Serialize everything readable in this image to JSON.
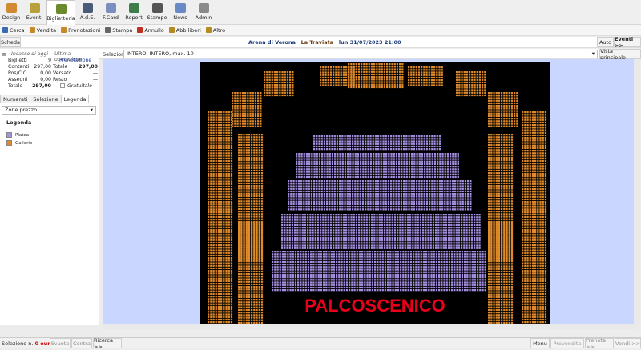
{
  "toolbar": {
    "items": [
      {
        "label": "Design",
        "color": "#d08a32"
      },
      {
        "label": "Eventi",
        "color": "#b7a13a"
      },
      {
        "label": "Biglietteria",
        "color": "#6a8a2c"
      },
      {
        "label": "A.d.E.",
        "color": "#4a5a7a"
      },
      {
        "label": "F.Card",
        "color": "#7a8fbf"
      },
      {
        "label": "Report",
        "color": "#3e7d4a"
      },
      {
        "label": "Stampe",
        "color": "#555555"
      },
      {
        "label": "News",
        "color": "#6a8ac7"
      },
      {
        "label": "Admin",
        "color": "#8a8a8a"
      }
    ]
  },
  "subbar": {
    "items": [
      {
        "label": "Cerca",
        "color": "#3a6ab0"
      },
      {
        "label": "Vendita",
        "color": "#c58a2a"
      },
      {
        "label": "Prenotazioni",
        "color": "#c58a2a"
      },
      {
        "label": "Stampa",
        "color": "#666666"
      },
      {
        "label": "Annullo",
        "color": "#c03020"
      },
      {
        "label": "Abb.liberi",
        "color": "#b58a20"
      },
      {
        "label": "Altro",
        "color": "#b58a20"
      }
    ]
  },
  "scheda": {
    "label": "Scheda",
    "venue": "Arena di Verona",
    "event": "La Traviata",
    "date": "lun 31/07/2023 21:00",
    "auto": "Auto",
    "eventi": "Eventi >>"
  },
  "selection": {
    "label": "Selezione",
    "value": "INTERO: INTERO, max. 10",
    "vista": "Vista principale"
  },
  "stats": {
    "incasso_title": "Incasso di oggi",
    "ultima_title": "Ultima operazione",
    "biglietti_lbl": "Biglietti",
    "biglietti_val": "9",
    "contanti_lbl": "Contanti",
    "contanti_val": "297,00",
    "posc_lbl": "Pos/C.C.",
    "posc_val": "0,00",
    "assegni_lbl": "Assegni",
    "assegni_val": "0,00",
    "totale_lbl": "Totale",
    "totale_val": "297,00",
    "prenotazione": "Prenotazione",
    "u_totale_lbl": "Totale",
    "u_totale_val": "297,00",
    "versato_lbl": "Versato",
    "versato_val": "—",
    "resto_lbl": "Resto",
    "resto_val": "—",
    "gratuito": "Gratuitale"
  },
  "left_tabs": [
    "Numerati",
    "Selezione",
    "Legenda"
  ],
  "zone": {
    "label": "Zone prezzo"
  },
  "legend": {
    "title": "Legenda",
    "items": [
      {
        "label": "Platea",
        "color": "#a58fe0"
      },
      {
        "label": "Gallerie",
        "color": "#e08a2a"
      }
    ]
  },
  "stage": {
    "label": "PALCOSCENICO"
  },
  "status": {
    "prefix": "Selezione n.",
    "count": "0",
    "eur": "eur 0,00",
    "svuota": "Svuota",
    "centra": "Centra",
    "ricerca": "Ricerca >>",
    "menu": "Menu",
    "prevendita": "Prevendita",
    "prenota": "Prenota >>",
    "vendi": "Vendi >>"
  },
  "chart_data": {}
}
